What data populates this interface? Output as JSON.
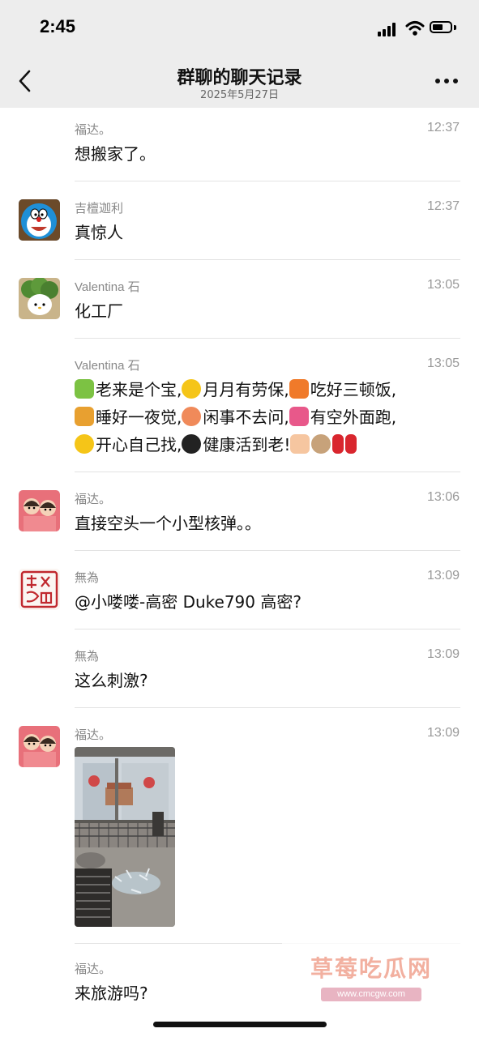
{
  "status_bar": {
    "time": "2:45"
  },
  "header": {
    "title": "群聊的聊天记录",
    "subtitle": "2025年5月27日"
  },
  "messages": [
    {
      "sender": "福达。",
      "time": "12:37",
      "text": "想搬家了。"
    },
    {
      "sender": "吉檀迦利",
      "time": "12:37",
      "text": "真惊人"
    },
    {
      "sender": "Valentina 石",
      "time": "13:05",
      "text": "化工厂"
    },
    {
      "sender": "Valentina 石",
      "time": "13:05",
      "segments": [
        "老来是个宝,",
        "月月有劳保,",
        "吃好三顿饭,",
        "睡好一夜觉,",
        "闲事不去问,",
        "有空外面跑,",
        "开心自己找,",
        "健康活到老!"
      ]
    },
    {
      "sender": "福达。",
      "time": "13:06",
      "text": "直接空头一个小型核弹。。"
    },
    {
      "sender": "無為",
      "time": "13:09",
      "text": "@小喽喽-高密 Duke790 高密?"
    },
    {
      "sender": "無為",
      "time": "13:09",
      "text": "这么刺激?"
    },
    {
      "sender": "福达。",
      "time": "13:09"
    },
    {
      "sender": "福达。",
      "text": "来旅游吗?"
    }
  ],
  "watermark": {
    "main": "草莓吃瓜网",
    "url": "www.cmcgw.com"
  },
  "icons": {
    "back": "chevron-left-icon",
    "more": "more-dots-icon",
    "signal": "signal-icon",
    "wifi": "wifi-icon",
    "battery": "battery-icon"
  },
  "colors": {
    "header_bg": "#ededed",
    "meta_text": "#9a9a9a",
    "divider": "#e3e3e3"
  }
}
